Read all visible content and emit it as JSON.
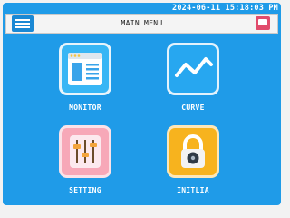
{
  "status_bar": {
    "datetime": "2024-06-11 15:18:03 PM"
  },
  "header": {
    "title": "MAIN MENU"
  },
  "icons": {
    "menu": "menu-icon",
    "screen": "display-icon"
  },
  "tiles": [
    {
      "label": "MONITOR",
      "icon": "monitor-window-icon",
      "color": "#38b6f5"
    },
    {
      "label": "CURVE",
      "icon": "line-chart-icon",
      "color": "#27a7f0"
    },
    {
      "label": "SETTING",
      "icon": "sliders-icon",
      "color": "#f7a8b8"
    },
    {
      "label": "INITLIA",
      "icon": "padlock-icon",
      "color": "#f7b31e"
    }
  ],
  "colors": {
    "screen_bg": "#1f9be8",
    "accent_menu": "#1a88d4",
    "accent_screen": "#e14b6c"
  }
}
